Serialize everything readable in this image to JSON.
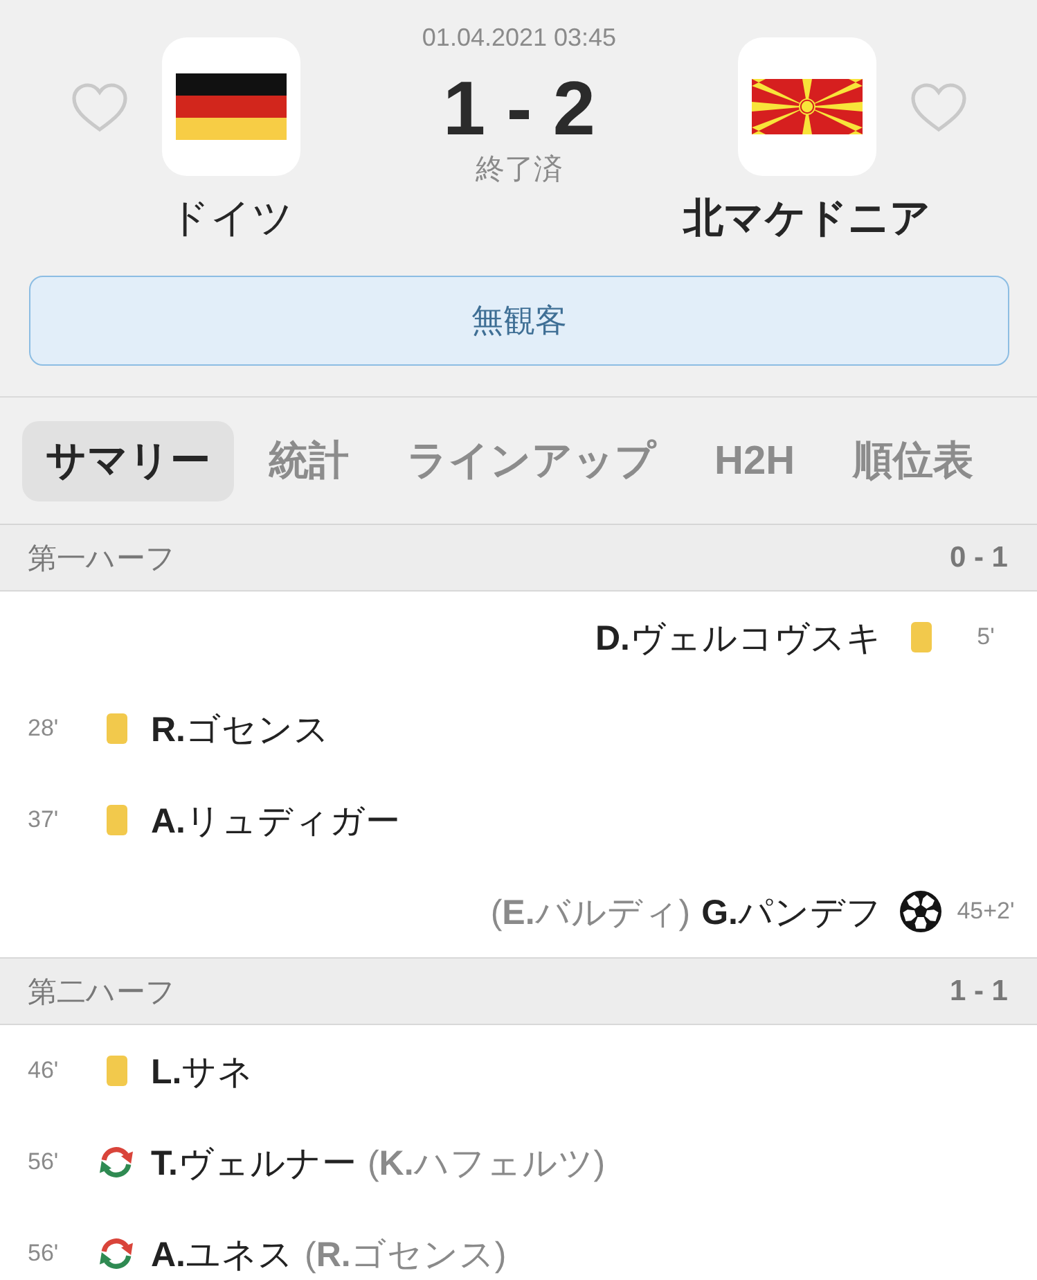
{
  "teams": [
    {
      "name": "ドイツ",
      "kind": "germany",
      "favorite": false,
      "winner": false
    },
    {
      "name": "北マケドニア",
      "kind": "north_macedonia",
      "favorite": false,
      "winner": true
    }
  ],
  "match": {
    "date": "01.04.2021 03:45",
    "score": "1 - 2",
    "status": "終了済"
  },
  "notice": "無観客",
  "tabs": [
    {
      "label": "サマリー",
      "selected": true
    },
    {
      "label": "統計",
      "selected": false
    },
    {
      "label": "ラインアップ",
      "selected": false
    },
    {
      "label": "H2H",
      "selected": false
    },
    {
      "label": "順位表",
      "selected": false
    }
  ],
  "sections": [
    {
      "title": "第一ハーフ",
      "score": "0 - 1",
      "events": [
        {
          "away": true,
          "minute": "5'",
          "kind": "yellow_card",
          "player": "**D.**ヴェルコヴスキ"
        },
        {
          "away": false,
          "minute": "28'",
          "kind": "yellow_card",
          "player": "**R.**ゴセンス"
        },
        {
          "away": false,
          "minute": "37'",
          "kind": "yellow_card",
          "player": "**A.**リュディガー"
        },
        {
          "away": true,
          "minute": "45+2'",
          "kind": "goal",
          "player": "**G.**パンデフ",
          "detail": "(**E.**バルディ)"
        }
      ]
    },
    {
      "title": "第二ハーフ",
      "score": "1 - 1",
      "events": [
        {
          "away": false,
          "minute": "46'",
          "kind": "yellow_card",
          "player": "**L.**サネ"
        },
        {
          "away": false,
          "minute": "56'",
          "kind": "substitution",
          "player": "**T.**ヴェルナー",
          "detail": "(**K.**ハフェルツ)"
        },
        {
          "away": false,
          "minute": "56'",
          "kind": "substitution",
          "player": "**A.**ユネス",
          "detail": "(**R.**ゴセンス)"
        }
      ]
    }
  ]
}
